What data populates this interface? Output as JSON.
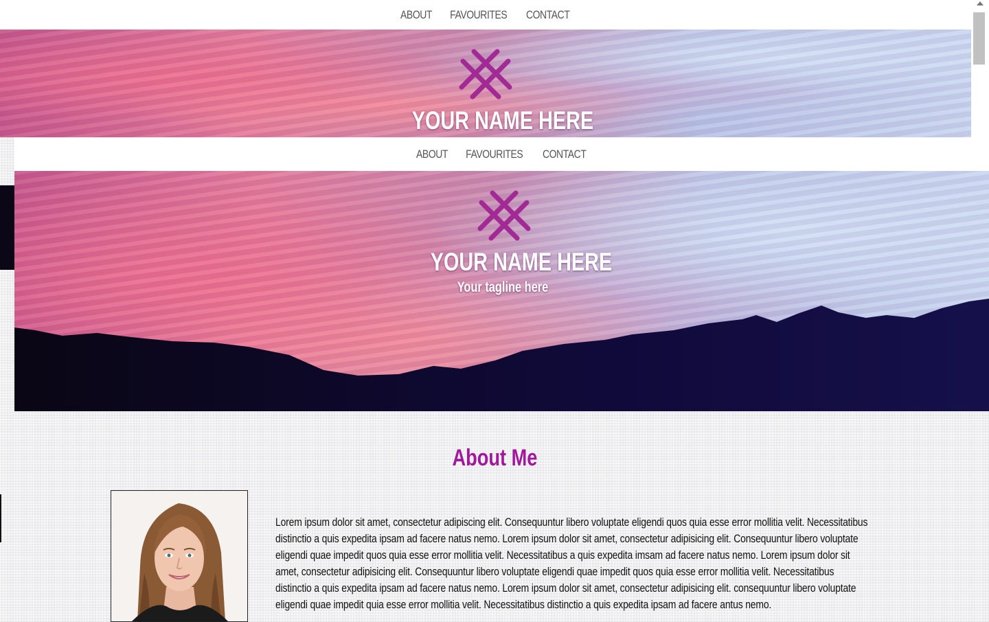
{
  "nav": {
    "items": [
      {
        "label": "ABOUT"
      },
      {
        "label": "FAVOURITES"
      },
      {
        "label": "CONTACT"
      }
    ]
  },
  "header": {
    "site_name": "YOUR NAME HERE",
    "tagline": "Your tagline here"
  },
  "about": {
    "title": "About Me",
    "body": "Lorem ipsum dolor sit amet, consectetur adipiscing elit. Consequuntur libero voluptate eligendi quos quia esse error mollitia velit. Necessitatibus distinctio a quis expedita ipsam ad facere natus nemo. Lorem ipsum dolor sit amet, consectetur adipisicing elit. Consequuntur libero voluptate eligendi quae impedit quos quia esse error mollitia velit. Necessitatibus a quis expedita imsam ad facere natus nemo. Lorem ipsum dolor sit amet, consectetur adipisicing elit. Consequuntur libero voluptate eligendi quae impedit quos quia esse error mollitia velit. Necessitatibus distinctio a quis expedita ipsam ad facere natus nemo. Lorem ipsum dolor sit amet, consectetur adipisicing elit. consequuntur libero voluptate eligendi quae impedit quia esse error mollitia velit. Necessitatibus distinctio a quis expedita ipsam ad facere antus nemo."
  },
  "colors": {
    "accent": "#a0199d",
    "nav_text": "#555555",
    "nav_bg": "#ffffff"
  },
  "icons": {
    "logo": "crosshatch-logo-icon",
    "portrait": "profile-photo"
  }
}
